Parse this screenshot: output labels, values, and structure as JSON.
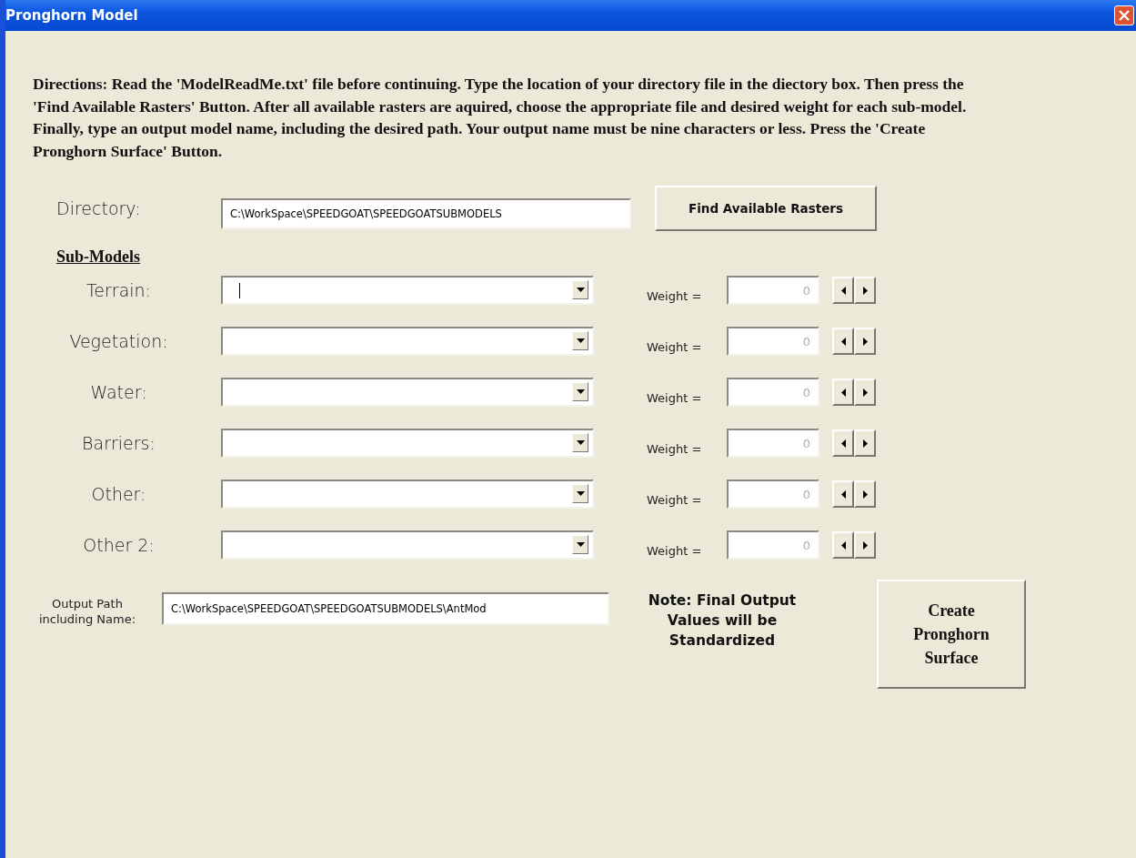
{
  "window": {
    "title": "Pronghorn Model"
  },
  "directions": "Directions:  Read the 'ModelReadMe.txt' file before continuing.  Type the location of your directory file in the diectory box.  Then press the 'Find Available Rasters' Button.  After all available rasters are aquired, choose the appropriate file and desired weight for each sub-model. Finally, type an output model name, including the desired path.  Your output name must be nine characters or less.  Press the 'Create Pronghorn Surface' Button.",
  "directory": {
    "label": "Directory:",
    "value": "C:\\WorkSpace\\SPEEDGOAT\\SPEEDGOATSUBMODELS",
    "button": "Find Available Rasters"
  },
  "submodels_heading": "Sub-Models",
  "submodels": [
    {
      "label": "Terrain:",
      "focused": true,
      "weight_label": "Weight =",
      "weight": "0"
    },
    {
      "label": "Vegetation:",
      "focused": false,
      "weight_label": "Weight =",
      "weight": "0"
    },
    {
      "label": "Water:",
      "focused": false,
      "weight_label": "Weight =",
      "weight": "0"
    },
    {
      "label": "Barriers:",
      "focused": false,
      "weight_label": "Weight =",
      "weight": "0"
    },
    {
      "label": "Other:",
      "focused": false,
      "weight_label": "Weight =",
      "weight": "0"
    },
    {
      "label": "Other 2:",
      "focused": false,
      "weight_label": "Weight =",
      "weight": "0"
    }
  ],
  "output": {
    "label": "Output Path including Name:",
    "value": "C:\\WorkSpace\\SPEEDGOAT\\SPEEDGOATSUBMODELS\\AntMod"
  },
  "note": "Note: Final Output Values will be Standardized",
  "create_button": "Create Pronghorn Surface"
}
